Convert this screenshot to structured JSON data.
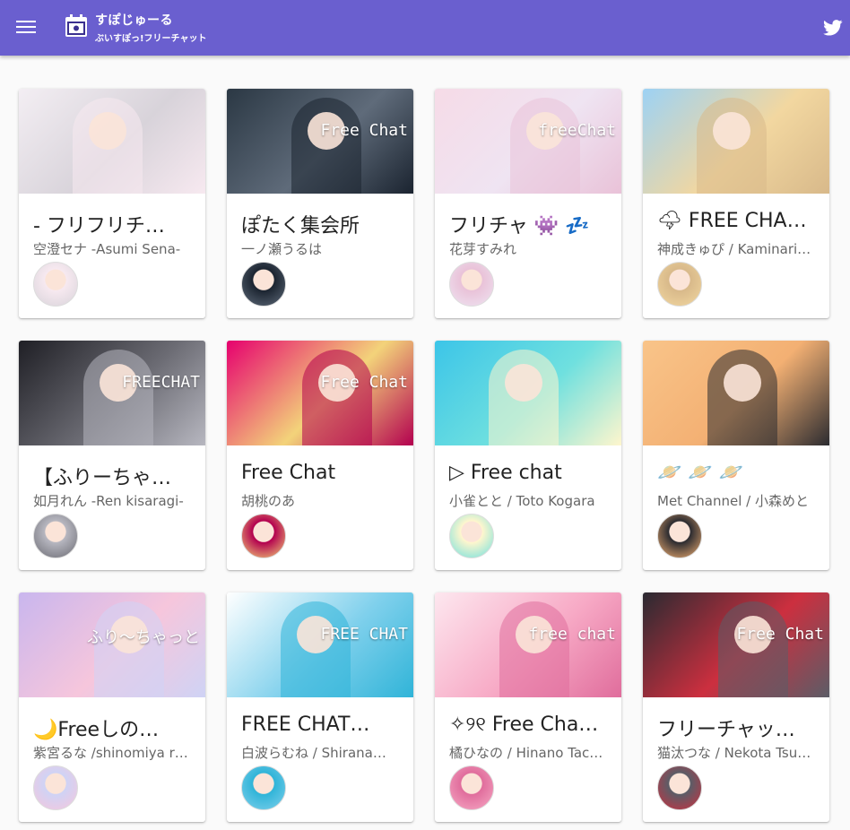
{
  "header": {
    "title": "すぽじゅーる",
    "subtitle": "ぶいすぽっ!フリーチャット",
    "menu_icon": "hamburger-menu-icon",
    "twitter_icon": "twitter-icon"
  },
  "cards": [
    {
      "title": "- フリフリチ…",
      "channel": "空澄セナ -Asumi Sena-",
      "thumb": "thumbnail-sena",
      "avatar": "avatar-sena",
      "colors": [
        "#f3eef3",
        "#d8d3da",
        "#f7e9f0"
      ],
      "overlay": ""
    },
    {
      "title": "ぽたく集会所",
      "channel": "一ノ瀬うるは",
      "thumb": "thumbnail-uruha",
      "avatar": "avatar-uruha",
      "colors": [
        "#2b3844",
        "#5f6b7a",
        "#1b2430"
      ],
      "overlay": "Free Chat"
    },
    {
      "title": "フリチャ 👾 💤",
      "channel": "花芽すみれ",
      "thumb": "thumbnail-sumire",
      "avatar": "avatar-sumire",
      "colors": [
        "#f6dbe7",
        "#efe4f2",
        "#e9c2d8"
      ],
      "overlay": "freeChat"
    },
    {
      "title": "🌩 FREE CHA…",
      "channel": "神成きゅぴ / Kaminari…",
      "thumb": "thumbnail-kyupi",
      "avatar": "avatar-kyupi",
      "colors": [
        "#9dd2f4",
        "#f2d7a0",
        "#d8b98a"
      ],
      "overlay": ""
    },
    {
      "title": "【ふりーちゃ…",
      "channel": "如月れん -Ren kisaragi-",
      "thumb": "thumbnail-ren",
      "avatar": "avatar-ren",
      "colors": [
        "#1f1f25",
        "#6b6b73",
        "#b7b7c0"
      ],
      "overlay": "FREECHAT"
    },
    {
      "title": "Free Chat",
      "channel": "胡桃のあ",
      "thumb": "thumbnail-noa",
      "avatar": "avatar-noa",
      "colors": [
        "#e6006e",
        "#f3d37a",
        "#b3004f"
      ],
      "overlay": "Free Chat"
    },
    {
      "title": "▷ Free chat",
      "channel": "小雀とと / Toto Kogara",
      "thumb": "thumbnail-toto",
      "avatar": "avatar-toto",
      "colors": [
        "#3cc5e8",
        "#6fe0df",
        "#fff6cd"
      ],
      "overlay": ""
    },
    {
      "title": "🪐 🪐 🪐",
      "channel": "Met Channel / 小森めと",
      "thumb": "thumbnail-met",
      "avatar": "avatar-met",
      "colors": [
        "#f9c489",
        "#f3b073",
        "#2b2b30"
      ],
      "overlay": ""
    },
    {
      "title": "🌙Freeしの…",
      "channel": "紫宮るな /shinomiya r…",
      "thumb": "thumbnail-runa",
      "avatar": "avatar-runa",
      "colors": [
        "#c9b6ee",
        "#f6c6dc",
        "#cfd3f5"
      ],
      "overlay": "ふり〜ちゃっと"
    },
    {
      "title": "FREE CHAT…",
      "channel": "白波らむね / Shirana…",
      "thumb": "thumbnail-ramune",
      "avatar": "avatar-ramune",
      "colors": [
        "#ffffff",
        "#7fd0ec",
        "#30b4d8"
      ],
      "overlay": "FREE CHAT"
    },
    {
      "title": "✧୨୧ Free Cha…",
      "channel": "橘ひなの / Hinano Tac…",
      "thumb": "thumbnail-hinano",
      "avatar": "avatar-hinano",
      "colors": [
        "#fde7ef",
        "#f7a9c5",
        "#e06d9c"
      ],
      "overlay": "free chat"
    },
    {
      "title": "フリーチャッ…",
      "channel": "猫汰つな / Nekota Tsu…",
      "thumb": "thumbnail-tsuna",
      "avatar": "avatar-tsuna",
      "colors": [
        "#2a2a31",
        "#cc2f3f",
        "#5b5d67"
      ],
      "overlay": "Free Chat"
    }
  ]
}
